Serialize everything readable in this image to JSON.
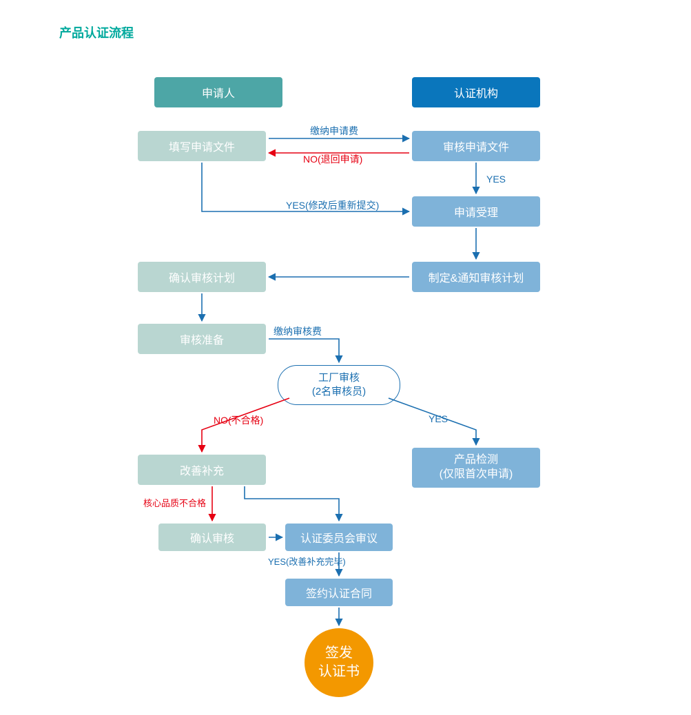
{
  "title": "产品认证流程",
  "colors": {
    "title": "#00a99d",
    "header_applicant": "#4da6a6",
    "header_org": "#0a76bc",
    "applicant_box": "#b9d6d1",
    "org_box": "#7fb3d9",
    "blue": "#1b6fb0",
    "red": "#e60012",
    "orange": "#f39800"
  },
  "headers": {
    "applicant": "申请人",
    "org": "认证机构"
  },
  "nodes": {
    "fill_application": "填写申请文件",
    "review_application": "审核申请文件",
    "accept_application": "申请受理",
    "plan_audit": "制定&通知审核计划",
    "confirm_plan": "确认审核计划",
    "prepare_audit": "审核准备",
    "factory_audit_l1": "工厂审核",
    "factory_audit_l2": "(2名审核员)",
    "improve": "改善补充",
    "confirm_audit": "确认审核",
    "committee": "认证委员会审议",
    "product_test_l1": "产品检测",
    "product_test_l2": "(仅限首次申请)",
    "sign_contract": "签约认证合同",
    "issue_cert_l1": "签发",
    "issue_cert_l2": "认证书"
  },
  "edges": {
    "pay_app_fee": "缴纳申请费",
    "no_return": "NO(退回申请)",
    "yes": "YES",
    "yes_resubmit": "YES(修改后重新提交)",
    "pay_audit_fee": "缴纳审核费",
    "no_fail": "NO(不合格)",
    "core_fail": "核心品质不合格",
    "yes_improved": "YES(改善补充完毕)"
  }
}
